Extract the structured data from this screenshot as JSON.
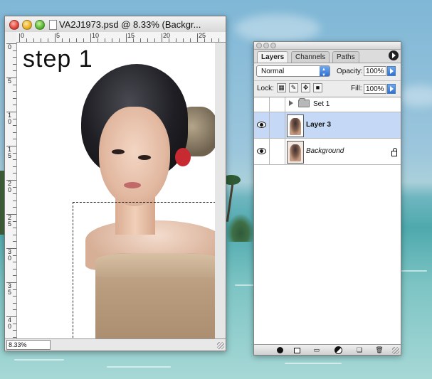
{
  "document": {
    "title": "VA2J1973.psd @ 8.33% (Backgr...",
    "canvas_text": "step 1",
    "zoom": "8.33%",
    "ruler_h_labels": [
      "0",
      "5",
      "10",
      "15",
      "20",
      "25"
    ],
    "ruler_v_labels": [
      "0",
      "5",
      "1\n0",
      "1\n5",
      "2\n0",
      "2\n5",
      "3\n0",
      "3\n5",
      "4\n0"
    ]
  },
  "layers_palette": {
    "tabs": [
      {
        "label": "Layers",
        "active": true
      },
      {
        "label": "Channels",
        "active": false
      },
      {
        "label": "Paths",
        "active": false
      }
    ],
    "blend_mode": "Normal",
    "opacity_label": "Opacity:",
    "opacity_value": "100%",
    "lock_label": "Lock:",
    "fill_label": "Fill:",
    "fill_value": "100%",
    "lock_buttons": [
      "lock-transparency-icon",
      "lock-image-icon",
      "lock-position-icon",
      "lock-all-icon"
    ],
    "layers": [
      {
        "name": "Set 1",
        "type": "set",
        "visible": false,
        "selected": false
      },
      {
        "name": "Layer 3",
        "type": "layer",
        "visible": true,
        "selected": true
      },
      {
        "name": "Background",
        "type": "background",
        "visible": true,
        "selected": false,
        "locked": true
      }
    ],
    "bottom_buttons": [
      "add-layer-style-icon",
      "add-mask-icon",
      "new-set-icon",
      "new-adjustment-layer-icon",
      "new-layer-icon",
      "trash-icon"
    ]
  },
  "colors": {
    "selected_layer": "#c5d9f6",
    "accent_blue": "#2f6fd6"
  }
}
